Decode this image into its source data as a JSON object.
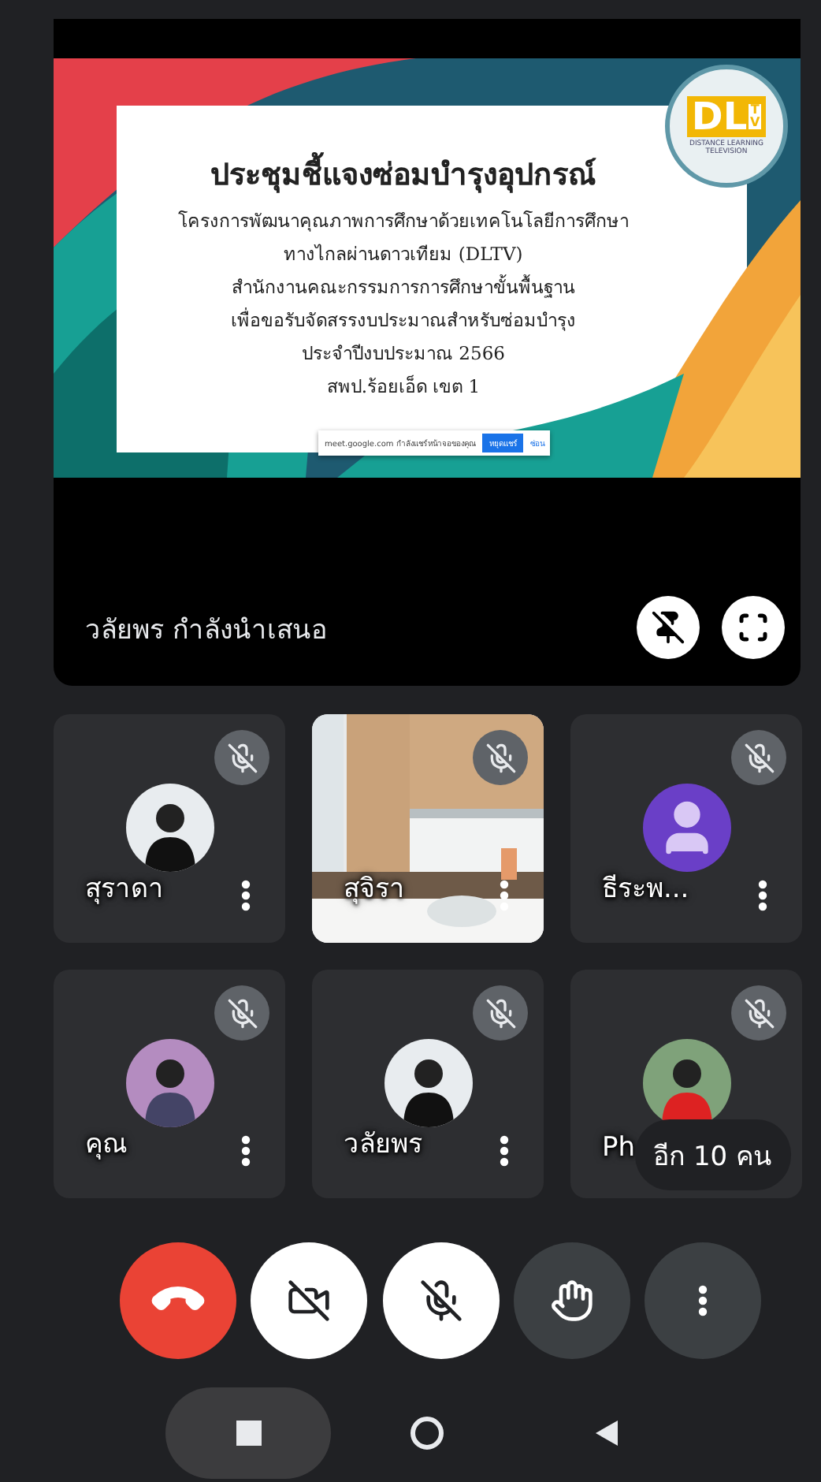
{
  "presentation": {
    "slide": {
      "title": "ประชุมชี้แจงซ่อมบำรุงอุปกรณ์",
      "lines": [
        "โครงการพัฒนาคุณภาพการศึกษาด้วยเทคโนโลยีการศึกษา",
        "ทางไกลผ่านดาวเทียม (DLTV)",
        "สำนักงานคณะกรรมการการศึกษาขั้นพื้นฐาน",
        "เพื่อขอรับจัดสรรงบประมาณสำหรับซ่อมบำรุง",
        "ประจำปีงบประมาณ 2566",
        "สพป.ร้อยเอ็ด เขต 1"
      ],
      "logo": {
        "letters": "DL",
        "sub": "TV",
        "tagline": "DISTANCE LEARNING TELEVISION"
      },
      "share_bar": {
        "message": "meet.google.com กำลังแชร์หน้าจอของคุณ",
        "stop": "หยุดแชร์",
        "hide": "ซ่อน"
      }
    },
    "caption": "วลัยพร กำลังนำเสนอ",
    "buttons": [
      {
        "kind": "unpin"
      },
      {
        "kind": "fullscreen"
      }
    ]
  },
  "tiles": [
    {
      "name": "สุราดา",
      "muted": true,
      "menu": true
    },
    {
      "name": "สุจิรา",
      "kind": "video",
      "muted": true,
      "menu": true
    },
    {
      "name": "ธีระพ...",
      "kind": "placeholder",
      "muted": true,
      "menu": true
    },
    {
      "name": "คุณ",
      "muted": true,
      "menu": true
    },
    {
      "name": "วลัยพร",
      "muted": true,
      "menu": true
    },
    {
      "name": "Ph",
      "muted": true,
      "menu": false
    }
  ],
  "overflow_badge": "อีก 10 คน",
  "controls": [
    {
      "kind": "end_call"
    },
    {
      "kind": "camera",
      "on": false
    },
    {
      "kind": "mic",
      "on": false
    },
    {
      "kind": "raise_hand"
    },
    {
      "kind": "more"
    }
  ],
  "nav": [
    {
      "kind": "recents"
    },
    {
      "kind": "home"
    },
    {
      "kind": "back"
    }
  ]
}
